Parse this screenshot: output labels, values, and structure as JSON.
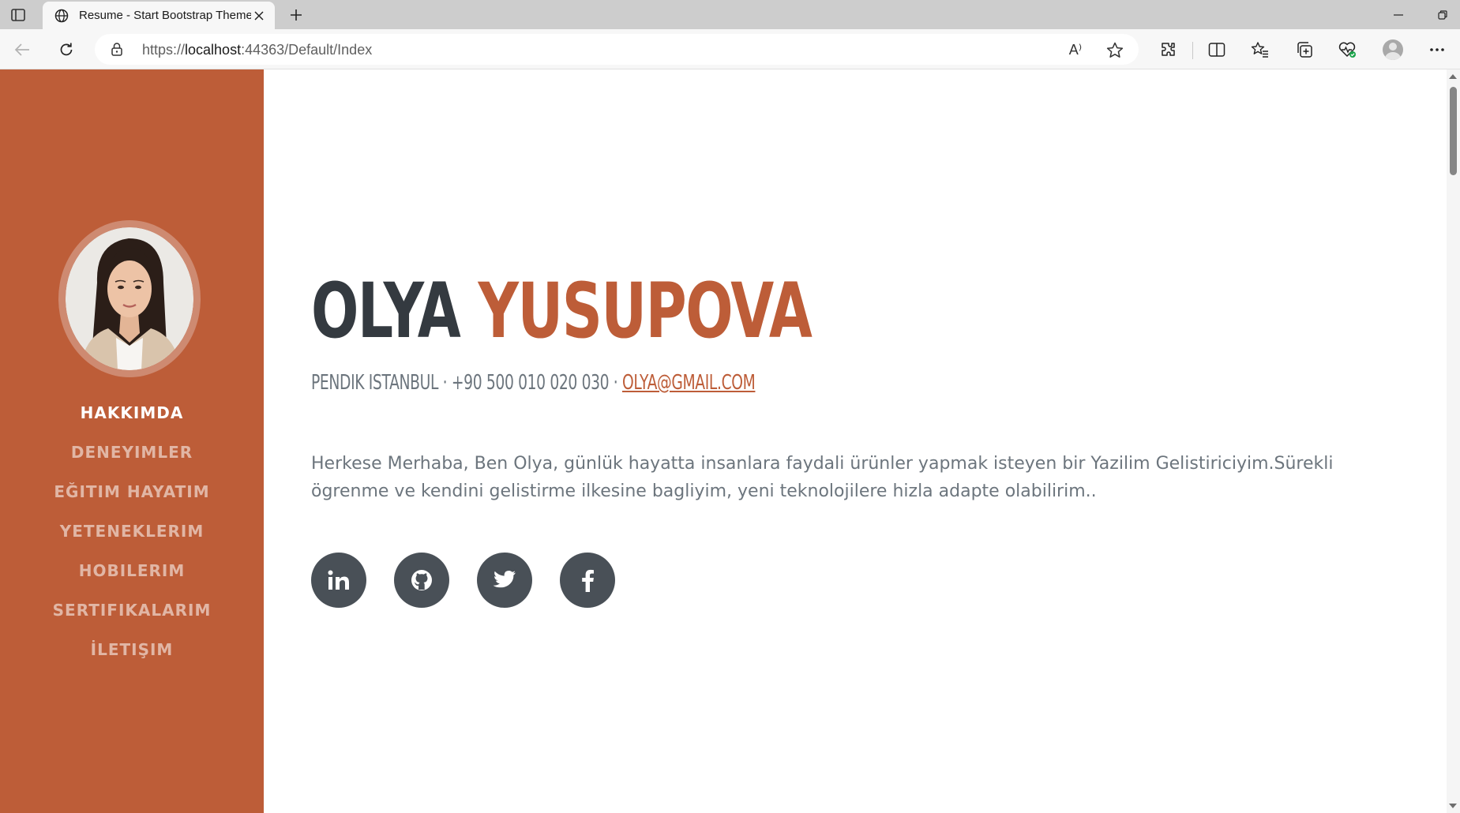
{
  "browser": {
    "tab_title": "Resume - Start Bootstrap Theme",
    "url_prefix": "https://",
    "url_host": "localhost",
    "url_path": ":44363/Default/Index",
    "read_aloud_label": "A⁾"
  },
  "sidebar": {
    "accent_color": "#bd5d38",
    "profile_alt": "Profile photo",
    "nav": [
      {
        "label": "HAKKIMDA",
        "active": true
      },
      {
        "label": "DENEYIMLER",
        "active": false
      },
      {
        "label": "EĞITIM HAYATIM",
        "active": false
      },
      {
        "label": "YETENEKLERIM",
        "active": false
      },
      {
        "label": "HOBILERIM",
        "active": false
      },
      {
        "label": "SERTIFIKALARIM",
        "active": false
      },
      {
        "label": "İLETIŞIM",
        "active": false
      }
    ]
  },
  "main": {
    "first_name": "OLYA",
    "last_name": "YUSUPOVA",
    "address": "PENDIK ISTANBUL · +90 500 010 020 030 · ",
    "email": "OLYA@GMAIL.COM",
    "about": "Herkese Merhaba, Ben Olya, günlük hayatta insanlara faydali ürünler yapmak isteyen bir Yazilim Gelistiriciyim.Sürekli ögrenme ve kendini gelistirme ilkesine bagliyim, yeni teknolojilere hizla adapte olabilirim..",
    "socials": [
      {
        "icon": "linkedin-icon",
        "label": "in"
      },
      {
        "icon": "github-icon"
      },
      {
        "icon": "twitter-icon"
      },
      {
        "icon": "facebook-icon",
        "label": "f"
      }
    ]
  }
}
